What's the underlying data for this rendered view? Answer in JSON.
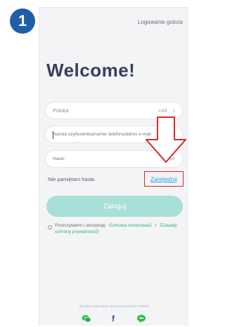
{
  "step_badge": "1",
  "header": {
    "guest_login": "Logowanie gościa"
  },
  "welcome": "Welcome!",
  "country_field": {
    "country": "Polska",
    "dial_code": "+48",
    "chevron": "chevron-right-icon"
  },
  "username_field": {
    "placeholder": "Nazwa użytkownika/numer telefonu/adres e-mail",
    "value": ""
  },
  "password_field": {
    "placeholder": "Hasło",
    "value": "",
    "toggle_icon": "eye-hidden-icon"
  },
  "links": {
    "forgot_password": "Nie pamiętam hasła",
    "register": "Zarejestruj"
  },
  "login_button": "Zaloguj",
  "terms": {
    "prefix": "Przeczytałem i akceptuję",
    "terms_link": "《Umowa serwisowa》",
    "conjunction": "i",
    "privacy_link": "《Zasady ochrony prywatności》"
  },
  "social": {
    "caption": "Szybkie logowanie za pomocą innych metod",
    "icons": [
      "wechat-icon",
      "facebook-icon",
      "line-icon"
    ]
  },
  "colors": {
    "accent": "#2fbfa6",
    "badge": "#1f5fa8",
    "highlight": "#d62a2a",
    "link": "#2f9bd8"
  }
}
